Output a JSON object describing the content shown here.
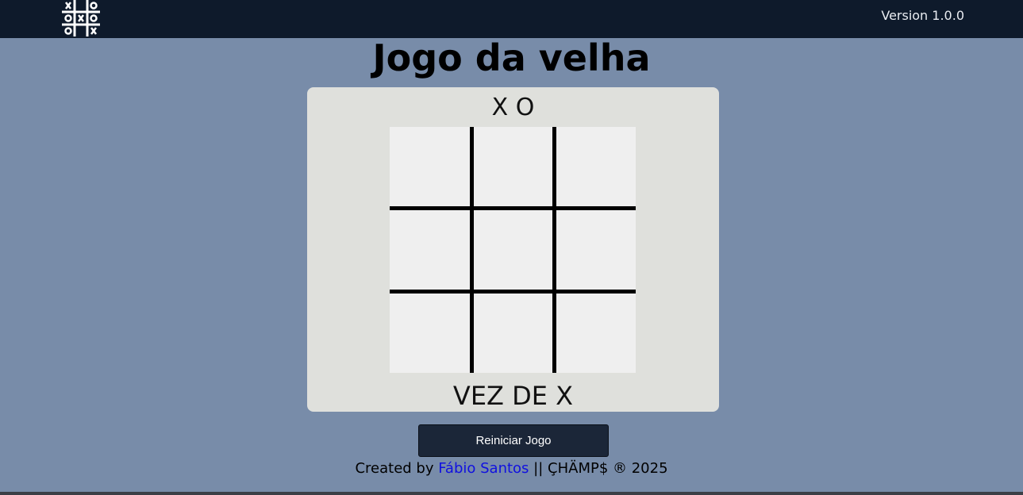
{
  "header": {
    "version": "Version 1.0.0",
    "logo_icon": "tic-tac-toe-logo-icon"
  },
  "page": {
    "title": "Jogo da velha"
  },
  "game": {
    "players": "X O",
    "board": [
      "",
      "",
      "",
      "",
      "",
      "",
      "",
      "",
      ""
    ],
    "turn_text": "VEZ DE X"
  },
  "controls": {
    "restart_label": "Reiniciar Jogo"
  },
  "footer": {
    "prefix": "Created by ",
    "author": "Fábio Santos",
    "suffix": " || ÇHÄMP$ ® 2025"
  },
  "colors": {
    "background": "#788ca9",
    "topbar": "#0e1a2b",
    "panel": "#dfe0dc",
    "board": "#efefef",
    "button": "#1b2638",
    "link": "#1010e0"
  }
}
